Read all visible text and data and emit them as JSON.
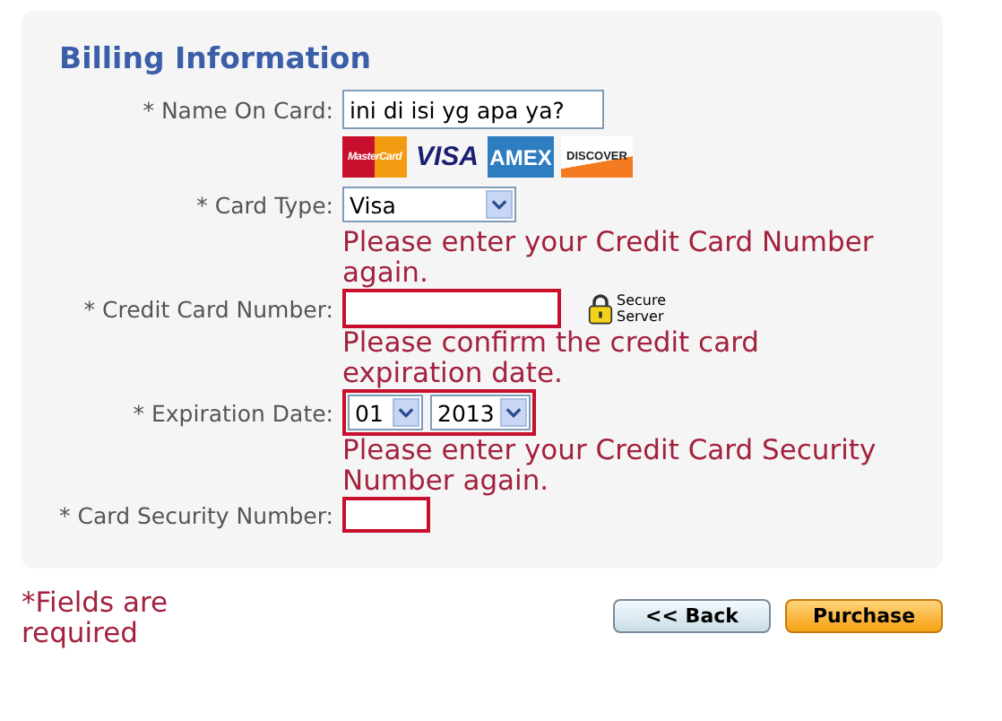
{
  "panel": {
    "title": "Billing Information"
  },
  "rows": [
    {
      "kind": "text",
      "label": "* Name On Card:",
      "value": "ini di isi yg apa ya?",
      "invalid": false
    },
    {
      "kind": "logos",
      "logos": [
        {
          "kind": "mastercard",
          "label": "MasterCard"
        },
        {
          "kind": "visa",
          "label": "VISA"
        },
        {
          "kind": "amex",
          "label": "AMEX"
        },
        {
          "kind": "discover",
          "label": "DISCOVER"
        }
      ]
    },
    {
      "kind": "select",
      "label": "* Card Type:",
      "value": "Visa"
    },
    {
      "kind": "text",
      "label": "* Credit Card Number:",
      "error": "Please enter your Credit Card Number again.",
      "invalid": true,
      "badge": [
        "Secure",
        "Server"
      ]
    },
    {
      "kind": "dates",
      "label": "* Expiration Date:",
      "error": "Please confirm the credit card expiration date.",
      "invalid": true,
      "month": "01",
      "year": "2013"
    },
    {
      "kind": "text",
      "label": "* Card Security Number:",
      "error": "Please enter your Credit Card Security Number again.",
      "invalid": true
    }
  ],
  "footer": {
    "note": "*Fields are required",
    "buttons": [
      {
        "kind": "back",
        "label": "<< Back"
      },
      {
        "kind": "primary",
        "label": "Purchase"
      }
    ]
  }
}
